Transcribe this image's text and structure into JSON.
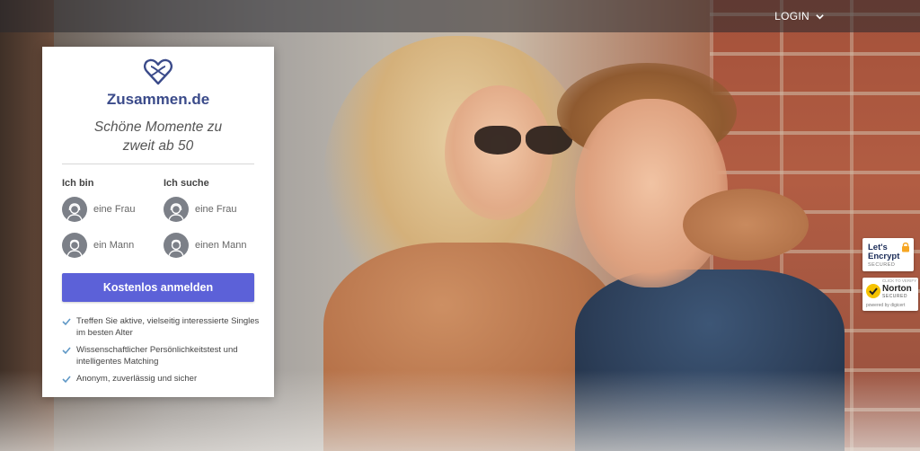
{
  "nav": {
    "login_label": "LOGIN"
  },
  "card": {
    "brand": "Zusammen.de",
    "tagline_line1": "Schöne Momente zu",
    "tagline_line2": "zweit ab 50",
    "i_am_label": "Ich bin",
    "seeking_label": "Ich suche",
    "i_am_options": [
      "eine Frau",
      "ein Mann"
    ],
    "seeking_options": [
      "eine Frau",
      "einen Mann"
    ],
    "cta_label": "Kostenlos anmelden",
    "benefits": [
      "Treffen Sie aktive, vielseitig interessierte Singles im besten Alter",
      "Wissenschaftlicher Persönlichkeitstest und intelligentes Matching",
      "Anonym, zuverlässig und sicher"
    ]
  },
  "badges": {
    "letsencrypt_line1": "Let's",
    "letsencrypt_line2": "Encrypt",
    "letsencrypt_line3": "SECURED",
    "norton_top": "CLICK TO VERIFY",
    "norton_name": "Norton",
    "norton_sub": "SECURED",
    "norton_powered": "powered by digicert"
  },
  "colors": {
    "brand": "#3b4b8a",
    "cta": "#5c61d8",
    "check": "#5f98c6",
    "avatar": "#7c8088"
  },
  "icons": {
    "logo": "heart-infinity-icon",
    "chevron": "chevron-down-icon",
    "female": "female-avatar-icon",
    "male": "male-avatar-icon",
    "check": "check-icon"
  }
}
